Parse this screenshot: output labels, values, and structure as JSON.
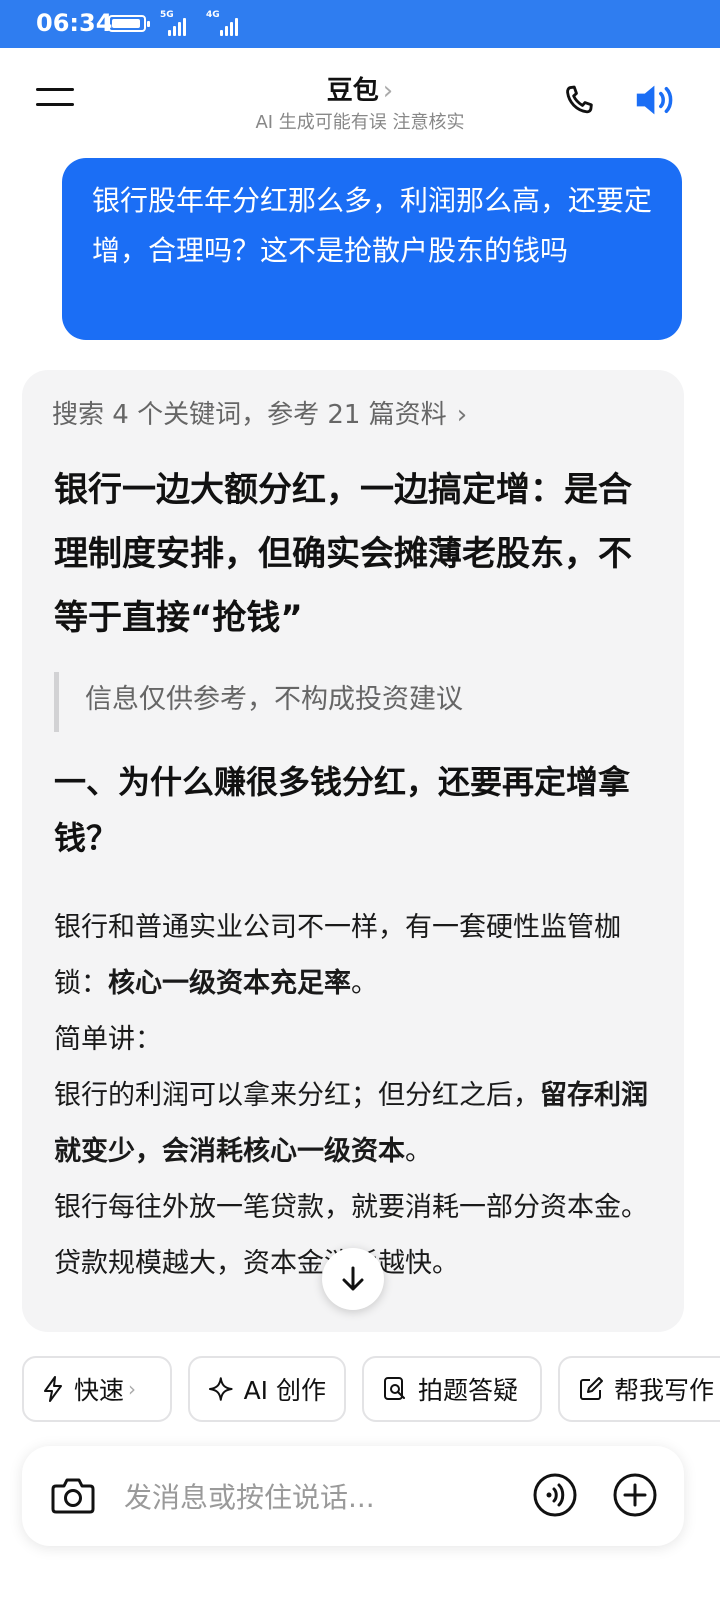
{
  "status": {
    "time": "06:34",
    "net1": "5G",
    "net2": "4G"
  },
  "header": {
    "title": "豆包",
    "title_chevron": "›",
    "subtitle": "AI 生成可能有误 注意核实"
  },
  "user_message": "银行股年年分红那么多，利润那么高，还要定增，合理吗？这不是抢散户股东的钱吗",
  "answer": {
    "search_line": "搜索 4 个关键词，参考 21 篇资料",
    "headline": "银行一边大额分红，一边搞定增：是合理制度安排，但确实会摊薄老股东，不等于直接“抢钱”",
    "disclaimer": "信息仅供参考，不构成投资建议",
    "section1_title": "一、为什么赚很多钱分红，还要再定增拿钱？",
    "p1_text": "银行和普通实业公司不一样，有一套硬性监管枷锁：",
    "p1_bold": "核心一级资本充足率",
    "p1_end": "。",
    "p2": "简单讲：",
    "p3_text": "银行的利润可以拿来分红；但分红之后，",
    "p3_bold": "留存利润就变少，会消耗核心一级资本",
    "p3_end": "。",
    "p4": "银行每往外放一笔贷款，就要消耗一部分资本金。贷款规模越大，资本金消耗越快。"
  },
  "chips": [
    {
      "label": "快速",
      "chevron": "›"
    },
    {
      "label": "AI 创作"
    },
    {
      "label": "拍题答疑"
    },
    {
      "label": "帮我写作"
    }
  ],
  "input": {
    "placeholder": "发消息或按住说话..."
  },
  "colors": {
    "status_bar": "#2f7df0",
    "user_bubble": "#1b6ef5",
    "speaker": "#1b6ef5"
  },
  "icons": [
    "menu-icon",
    "phone-icon",
    "speaker-icon",
    "arrow-down-icon",
    "lightning-icon",
    "sparkle-icon",
    "search-doc-icon",
    "edit-icon",
    "camera-icon",
    "voice-icon",
    "plus-icon"
  ]
}
